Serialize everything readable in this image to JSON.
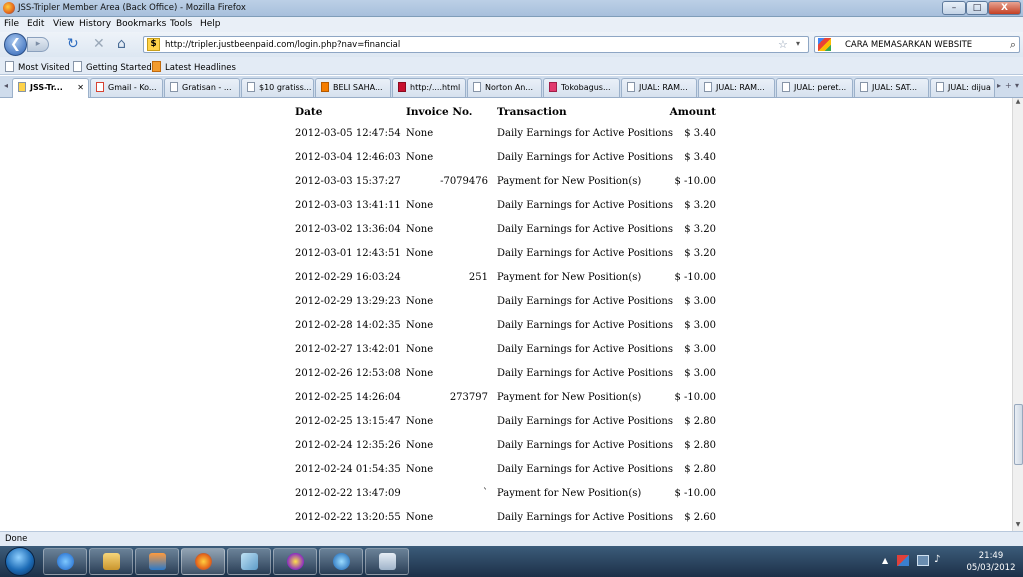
{
  "window": {
    "title": "JSS-Tripler Member Area (Back Office) - Mozilla Firefox",
    "min": "–",
    "max": "□",
    "close": "X"
  },
  "menu": [
    "File",
    "Edit",
    "View",
    "History",
    "Bookmarks",
    "Tools",
    "Help"
  ],
  "nav": {
    "url": "http://tripler.justbeenpaid.com/login.php?nav=financial",
    "search_value": "CARA MEMASARKAN WEBSITE",
    "site_badge": "$"
  },
  "bookmarks": [
    "Most Visited",
    "Getting Started",
    "Latest Headlines"
  ],
  "tabs": [
    "JSS-Tr...",
    "Gmail - Ko...",
    "Gratisan - ...",
    "$10 gratiss...",
    "BELI SAHA...",
    "http:/....html",
    "Norton An...",
    "Tokobagus...",
    "JUAL: RAM...",
    "JUAL: RAM...",
    "JUAL: peret...",
    "JUAL: SAT...",
    "JUAL: dijua"
  ],
  "table": {
    "headers": {
      "date": "Date",
      "invoice": "Invoice No.",
      "transaction": "Transaction",
      "amount": "Amount"
    },
    "rows": [
      {
        "date": "2012-03-05 12:47:54",
        "invoice": "None",
        "transaction": "Daily Earnings for Active Positions",
        "amount": "$ 3.40"
      },
      {
        "date": "2012-03-04 12:46:03",
        "invoice": "None",
        "transaction": "Daily Earnings for Active Positions",
        "amount": "$ 3.40"
      },
      {
        "date": "2012-03-03 15:37:27",
        "invoice": "-7079476",
        "transaction": "Payment for New Position(s)",
        "amount": "$ -10.00"
      },
      {
        "date": "2012-03-03 13:41:11",
        "invoice": "None",
        "transaction": "Daily Earnings for Active Positions",
        "amount": "$ 3.20"
      },
      {
        "date": "2012-03-02 13:36:04",
        "invoice": "None",
        "transaction": "Daily Earnings for Active Positions",
        "amount": "$ 3.20"
      },
      {
        "date": "2012-03-01 12:43:51",
        "invoice": "None",
        "transaction": "Daily Earnings for Active Positions",
        "amount": "$ 3.20"
      },
      {
        "date": "2012-02-29 16:03:24",
        "invoice": "251",
        "transaction": "Payment for New Position(s)",
        "amount": "$ -10.00"
      },
      {
        "date": "2012-02-29 13:29:23",
        "invoice": "None",
        "transaction": "Daily Earnings for Active Positions",
        "amount": "$ 3.00"
      },
      {
        "date": "2012-02-28 14:02:35",
        "invoice": "None",
        "transaction": "Daily Earnings for Active Positions",
        "amount": "$ 3.00"
      },
      {
        "date": "2012-02-27 13:42:01",
        "invoice": "None",
        "transaction": "Daily Earnings for Active Positions",
        "amount": "$ 3.00"
      },
      {
        "date": "2012-02-26 12:53:08",
        "invoice": "None",
        "transaction": "Daily Earnings for Active Positions",
        "amount": "$ 3.00"
      },
      {
        "date": "2012-02-25 14:26:04",
        "invoice": "273797",
        "transaction": "Payment for New Position(s)",
        "amount": "$ -10.00"
      },
      {
        "date": "2012-02-25 13:15:47",
        "invoice": "None",
        "transaction": "Daily Earnings for Active Positions",
        "amount": "$ 2.80"
      },
      {
        "date": "2012-02-24 12:35:26",
        "invoice": "None",
        "transaction": "Daily Earnings for Active Positions",
        "amount": "$ 2.80"
      },
      {
        "date": "2012-02-24 01:54:35",
        "invoice": "None",
        "transaction": "Daily Earnings for Active Positions",
        "amount": "$ 2.80"
      },
      {
        "date": "2012-02-22 13:47:09",
        "invoice": "`",
        "transaction": "Payment for New Position(s)",
        "amount": "$ -10.00"
      },
      {
        "date": "2012-02-22 13:20:55",
        "invoice": "None",
        "transaction": "Daily Earnings for Active Positions",
        "amount": "$ 2.60"
      }
    ]
  },
  "status": {
    "text": "Done"
  },
  "clock": {
    "time": "21:49",
    "date": "05/03/2012"
  },
  "colors": {
    "titlebar": "#a7bfdc",
    "close_button": "#c33f23",
    "taskbar": "#1c3048"
  },
  "icons": [
    "firefox-icon",
    "back-icon",
    "forward-icon",
    "reload-icon",
    "stop-icon",
    "home-icon",
    "star-icon",
    "google-icon",
    "search-icon",
    "start-orb-icon",
    "ie-icon",
    "explorer-icon",
    "media-player-icon",
    "firefox-icon",
    "notepad-icon",
    "yahoo-messenger-icon",
    "globe-icon",
    "calculator-icon"
  ]
}
